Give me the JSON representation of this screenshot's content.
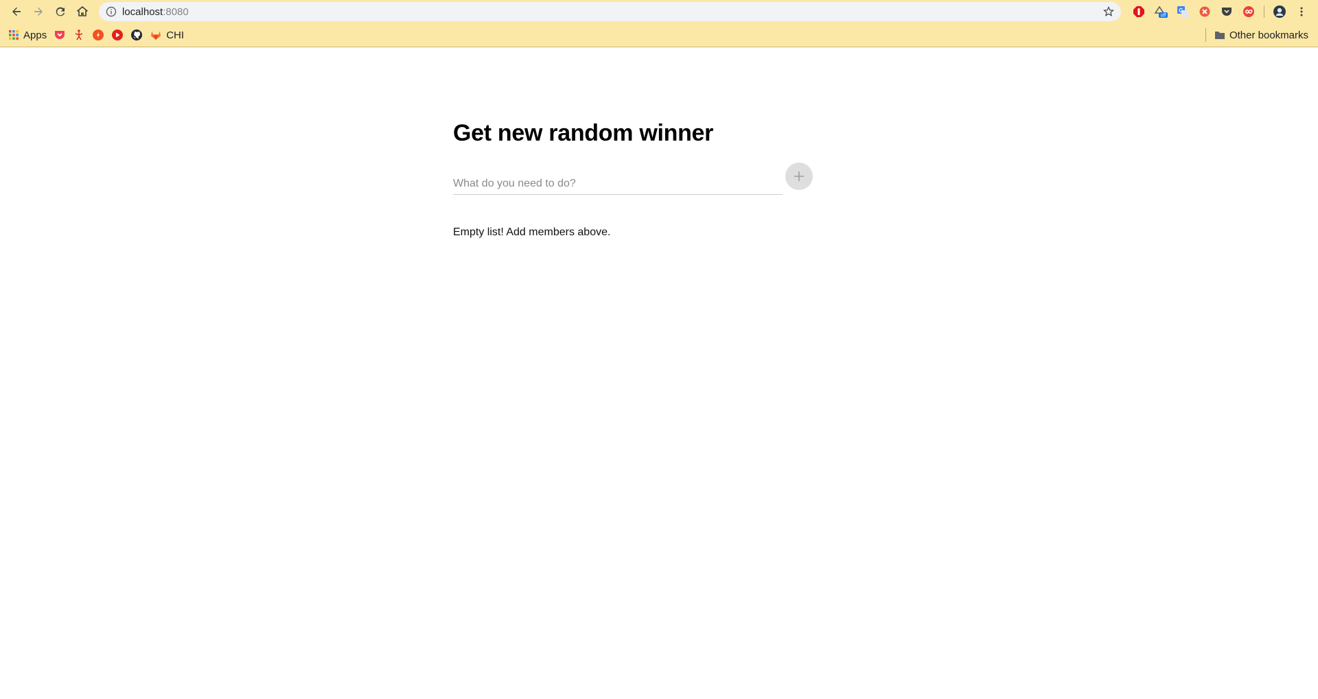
{
  "browser": {
    "url_host": "localhost",
    "url_port": ":8080",
    "bookmarks": [
      {
        "label": "Apps",
        "icon": "apps-grid-icon"
      },
      {
        "label": "",
        "icon": "pocket-icon"
      },
      {
        "label": "",
        "icon": "figure-icon"
      },
      {
        "label": "",
        "icon": "red-badge-icon"
      },
      {
        "label": "",
        "icon": "youtube-icon"
      },
      {
        "label": "",
        "icon": "github-icon"
      },
      {
        "label": "CHI",
        "icon": "gitlab-icon"
      }
    ],
    "other_bookmarks": "Other bookmarks",
    "extensions": [
      "adblock-icon",
      "ext-off-icon",
      "translate-icon",
      "red-x-icon",
      "pocket-icon",
      "infinity-icon",
      "profile-icon"
    ]
  },
  "page": {
    "title": "Get new random winner",
    "input_placeholder": "What do you need to do?",
    "add_symbol": "+",
    "empty_message": "Empty list! Add members above."
  },
  "colors": {
    "chrome_bg": "#fbe8a6",
    "add_button": "#dedede"
  }
}
